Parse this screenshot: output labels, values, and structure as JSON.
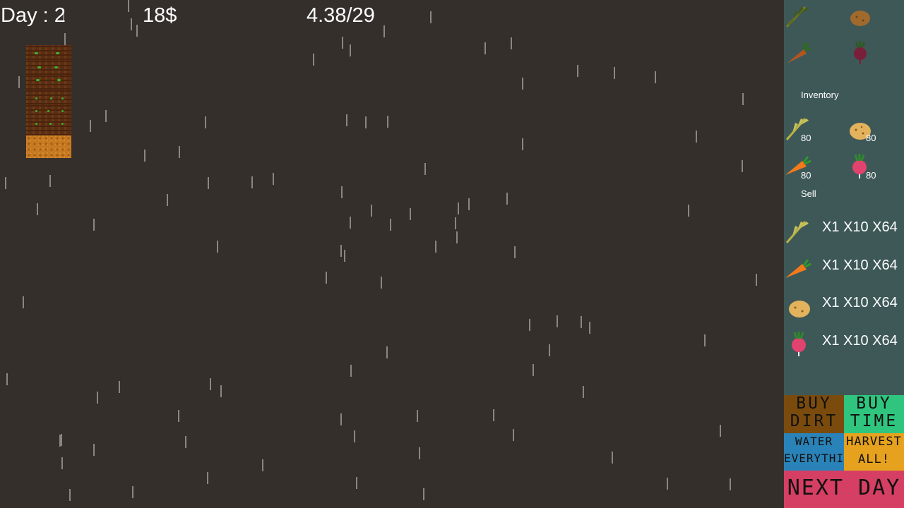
{
  "hud": {
    "day": "Day : 2",
    "money": "18$",
    "time": "4.38/29"
  },
  "seeds": [
    {
      "icon": "wheat-icon"
    },
    {
      "icon": "potato-icon"
    },
    {
      "icon": "carrot-icon"
    },
    {
      "icon": "beet-icon"
    }
  ],
  "inventory": {
    "label": "Inventory",
    "items": [
      {
        "icon": "wheat-icon",
        "count": "80"
      },
      {
        "icon": "potato-icon",
        "count": "80"
      },
      {
        "icon": "carrot-icon",
        "count": "80"
      },
      {
        "icon": "radish-icon",
        "count": "80"
      }
    ]
  },
  "sell": {
    "label": "Sell",
    "rows": [
      {
        "icon": "wheat-icon",
        "options": "X1 X10 X64"
      },
      {
        "icon": "carrot-icon",
        "options": "X1 X10 X64"
      },
      {
        "icon": "potato-icon",
        "options": "X1 X10 X64"
      },
      {
        "icon": "radish-icon",
        "options": "X1 X10 X64"
      }
    ]
  },
  "buttons": {
    "buy_dirt": "BUY\nDIRT",
    "buy_time": "BUY\nTIME",
    "water_all": "WATER\nEVERYTHING",
    "harvest_all": "HARVEST\nALL!",
    "next_day": "NEXT DAY"
  },
  "colors": {
    "background": "#352f2c",
    "sidebar": "#3e5858",
    "buy_dirt": "#7a4b0d",
    "buy_time": "#2fc57e",
    "water_all": "#2a83b8",
    "harvest_all": "#e6a21e",
    "next_day": "#d53f63"
  }
}
